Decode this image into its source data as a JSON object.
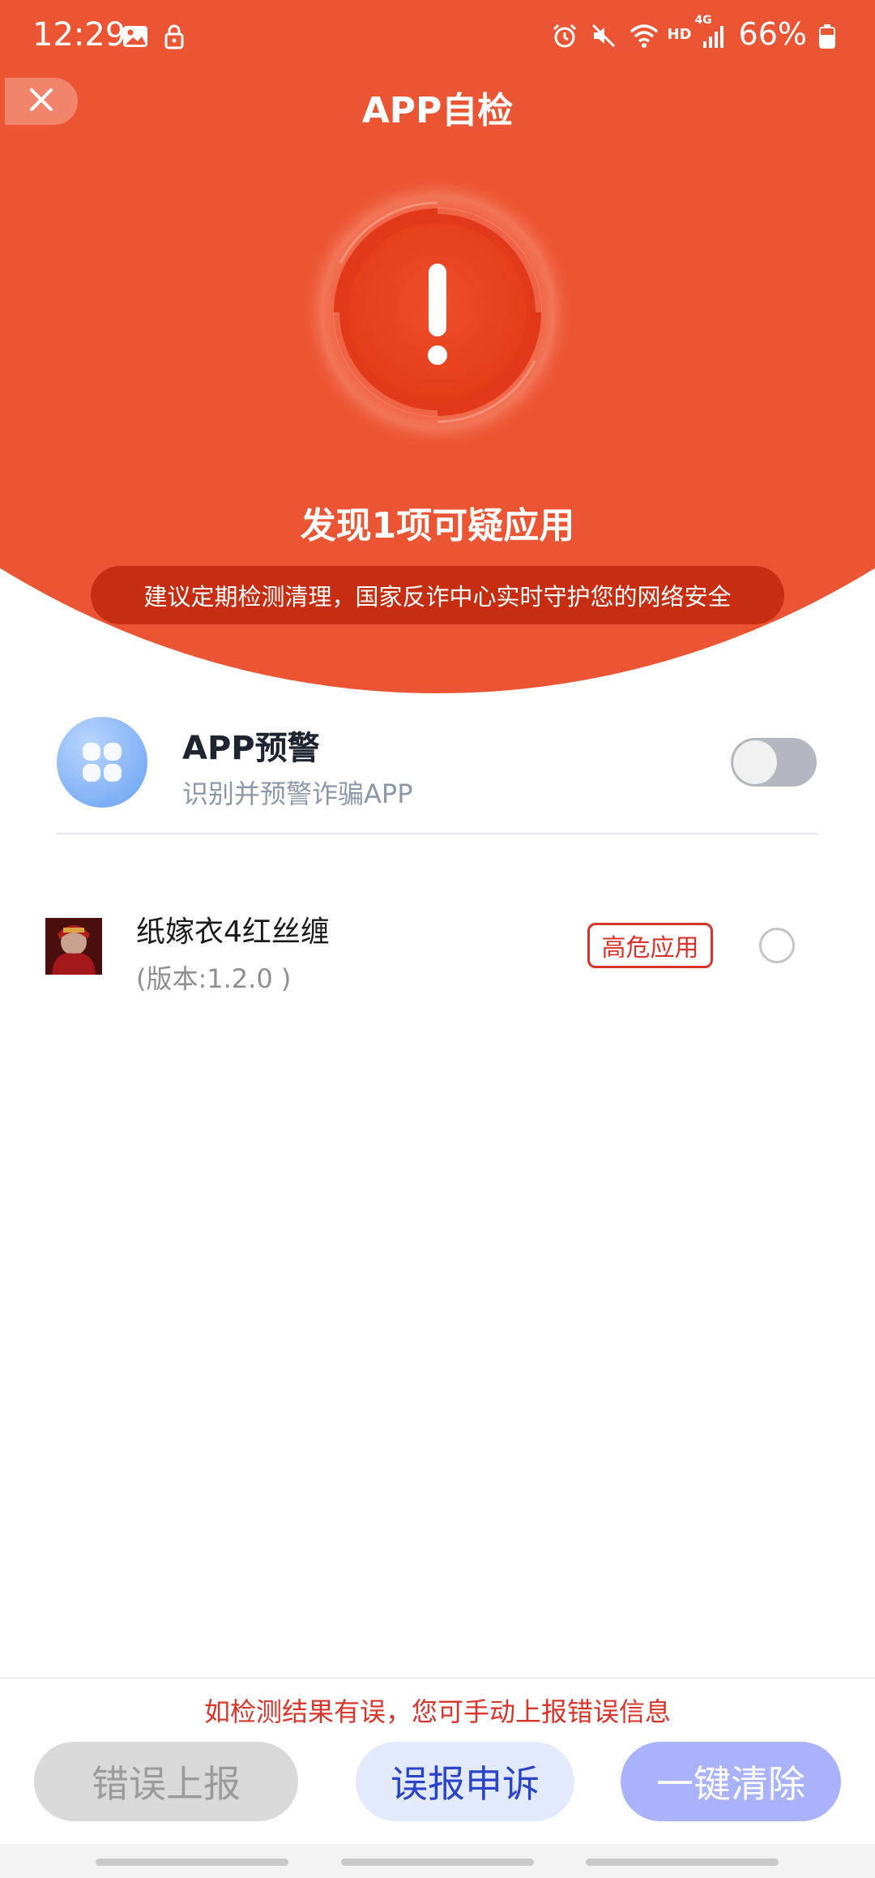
{
  "status_bar": {
    "time": "12:29",
    "network_label": "HD",
    "net_type": "4G",
    "battery": "66%"
  },
  "header": {
    "title": "APP自检",
    "close_icon": "close-icon"
  },
  "alert": {
    "symbol": "!",
    "headline": "发现1项可疑应用",
    "advice": "建议定期检测清理，国家反诈中心实时守护您的网络安全"
  },
  "app_warning": {
    "title": "APP预警",
    "subtitle": "识别并预警诈骗APP",
    "toggle_on": false
  },
  "apps": [
    {
      "name": "纸嫁衣4红丝缠",
      "version": "(版本:1.2.0 )",
      "badge": "高危应用",
      "selected": false
    }
  ],
  "footer": {
    "hint": "如检测结果有误，您可手动上报错误信息",
    "report_label": "错误上报",
    "appeal_label": "误报申诉",
    "clean_label": "一键清除"
  },
  "colors": {
    "header_orange": "#ec5533",
    "danger_red": "#d8342a",
    "appeal_blue": "#2a44c9",
    "clean_purple": "#a9b2fb"
  }
}
